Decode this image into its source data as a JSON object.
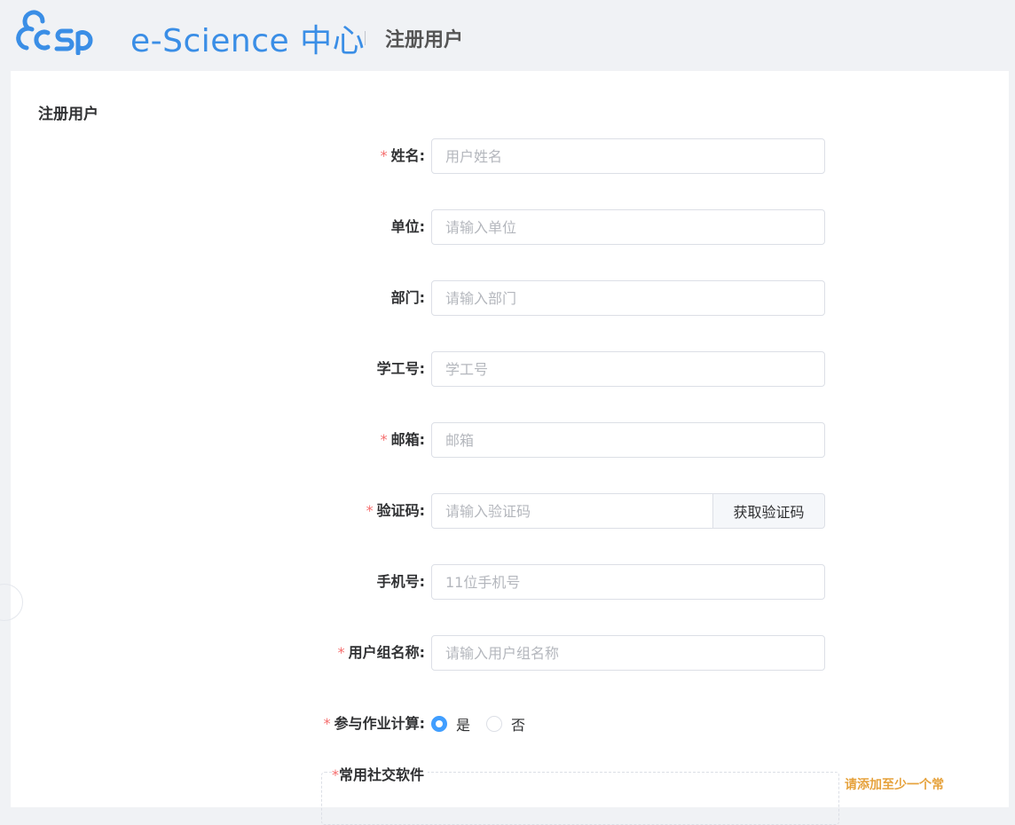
{
  "header": {
    "brand": "e-Science 中心",
    "title": "注册用户",
    "logo_icon": "csp-cloud-logo-icon",
    "brand_color": "#3a8ee6"
  },
  "form": {
    "title": "注册用户",
    "fields": [
      {
        "label": "姓名:",
        "required": true,
        "placeholder": "用户姓名"
      },
      {
        "label": "单位:",
        "required": false,
        "placeholder": "请输入单位"
      },
      {
        "label": "部门:",
        "required": false,
        "placeholder": "请输入部门"
      },
      {
        "label": "学工号:",
        "required": false,
        "placeholder": "学工号"
      },
      {
        "label": "邮箱:",
        "required": true,
        "placeholder": "邮箱"
      },
      {
        "label": "验证码:",
        "required": true,
        "placeholder": "请输入验证码",
        "button": "获取验证码"
      },
      {
        "label": "手机号:",
        "required": false,
        "placeholder": "11位手机号"
      },
      {
        "label": "用户组名称:",
        "required": true,
        "placeholder": "请输入用户组名称"
      }
    ],
    "job_compute": {
      "label": "参与作业计算:",
      "required": true,
      "options": [
        {
          "label": "是",
          "checked": true
        },
        {
          "label": "否",
          "checked": false
        }
      ]
    },
    "social": {
      "label": "常用社交软件",
      "required_mark": "*",
      "hint": "请添加至少一个常"
    },
    "required_mark": "*"
  },
  "colors": {
    "accent": "#409eff",
    "required": "#f56c6c",
    "warning": "#e6a23c"
  }
}
